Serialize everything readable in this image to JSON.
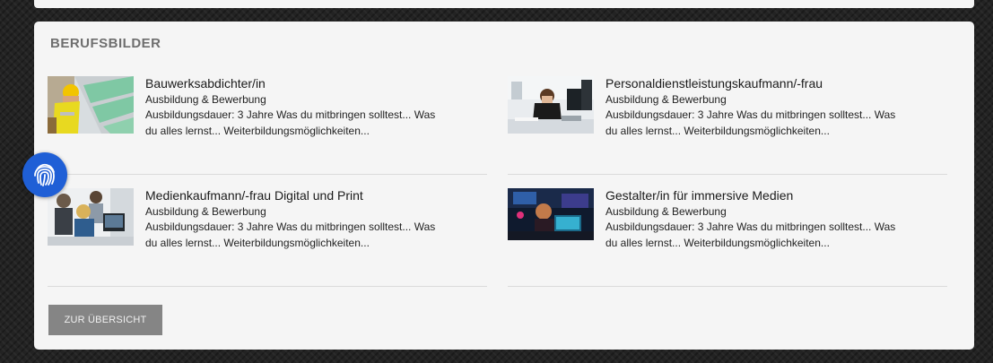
{
  "section": {
    "title": "BERUFSBILDER"
  },
  "jobs": [
    {
      "title": "Bauwerksabdichter/in",
      "category": "Ausbildung & Bewerbung",
      "description": "Ausbildungsdauer: 3 Jahre Was du mitbringen solltest... Was du alles lernst... Weiterbildungsmöglichkeiten...",
      "image": "construction-worker-photo"
    },
    {
      "title": "Personaldienstleistungskaufmann/-frau",
      "category": "Ausbildung & Bewerbung",
      "description": "Ausbildungsdauer: 3 Jahre Was du mitbringen solltest... Was du alles lernst... Weiterbildungsmöglichkeiten...",
      "image": "office-desk-photo"
    },
    {
      "title": "Medienkaufmann/-frau Digital und Print",
      "category": "Ausbildung & Bewerbung",
      "description": "Ausbildungsdauer: 3 Jahre Was du mitbringen solltest... Was du alles lernst... Weiterbildungsmöglichkeiten...",
      "image": "team-at-computer-photo"
    },
    {
      "title": "Gestalter/in für immersive Medien",
      "category": "Ausbildung & Bewerbung",
      "description": "Ausbildungsdauer: 3 Jahre Was du mitbringen solltest... Was du alles lernst... Weiterbildungsmöglichkeiten...",
      "image": "vr-studio-photo"
    }
  ],
  "overview_button": {
    "label": "ZUR ÜBERSICHT"
  },
  "badge": {
    "icon": "fingerprint-icon",
    "color": "#1f5fd6"
  }
}
